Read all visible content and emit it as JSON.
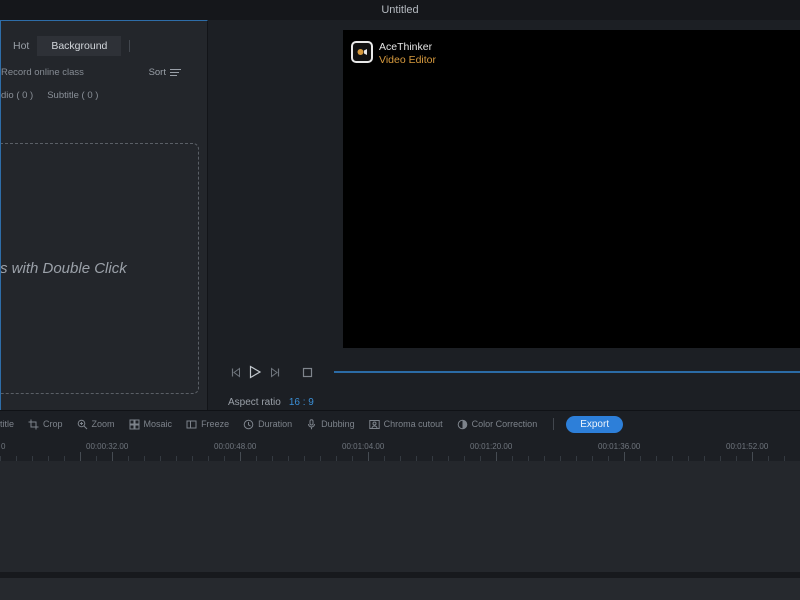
{
  "title_bar": {
    "title": "Untitled"
  },
  "library": {
    "tabs": [
      {
        "label": "Hot"
      },
      {
        "label": "Background"
      }
    ],
    "record_label": "Record online class",
    "sort_label": "Sort",
    "subtabs": [
      {
        "label": "dio ( 0 )"
      },
      {
        "label": "Subtitle ( 0 )"
      }
    ],
    "dropzone_text": "s with Double Click"
  },
  "preview": {
    "brand": {
      "name": "AceThinker",
      "product": "Video Editor"
    },
    "aspect_ratio_label": "Aspect ratio",
    "aspect_ratio_value": "16 : 9"
  },
  "toolbar": {
    "items": [
      {
        "label": "title",
        "icon": "subtitle-icon"
      },
      {
        "label": "Crop",
        "icon": "crop-icon"
      },
      {
        "label": "Zoom",
        "icon": "zoom-icon"
      },
      {
        "label": "Mosaic",
        "icon": "mosaic-icon"
      },
      {
        "label": "Freeze",
        "icon": "freeze-icon"
      },
      {
        "label": "Duration",
        "icon": "duration-icon"
      },
      {
        "label": "Dubbing",
        "icon": "dubbing-icon"
      },
      {
        "label": "Chroma cutout",
        "icon": "chroma-cutout-icon"
      },
      {
        "label": "Color Correction",
        "icon": "color-correction-icon"
      }
    ],
    "export_label": "Export"
  },
  "timeline": {
    "ruler_labels": [
      "0",
      "00:00:32.00",
      "00:00:48.00",
      "00:01:04.00",
      "00:01:20.00",
      "00:01:36.00",
      "00:01:52.00"
    ]
  },
  "colors": {
    "accent": "#2d7fd9",
    "brand_orange": "#d79a3e"
  }
}
